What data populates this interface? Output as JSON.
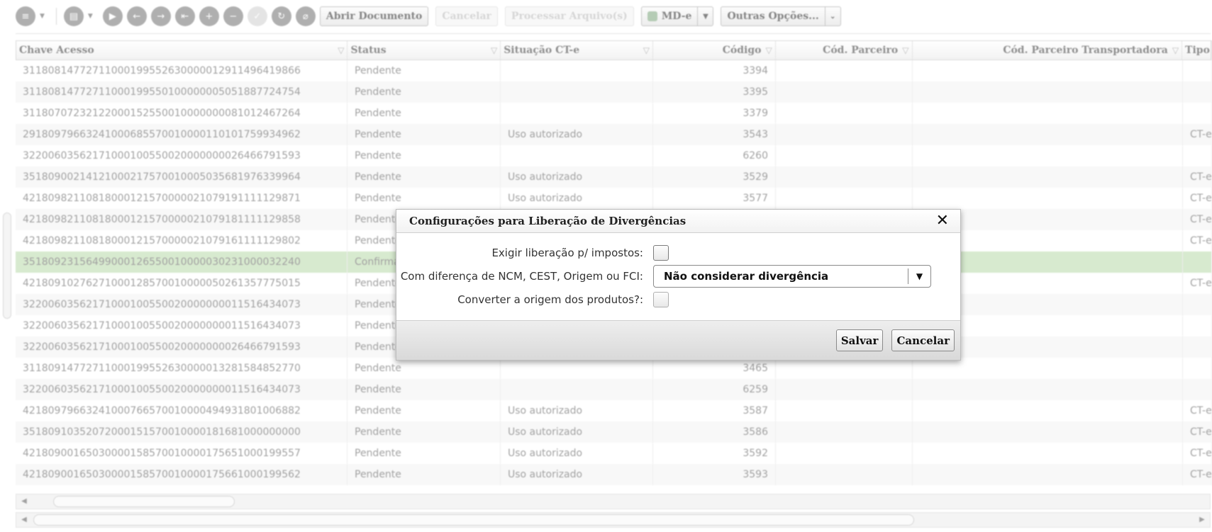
{
  "toolbar": {
    "open_document": "Abrir Documento",
    "cancel": "Cancelar",
    "process_files": "Processar Arquivo(s)",
    "mde": "MD-e",
    "other_options": "Outras Opções..."
  },
  "grid": {
    "columns": [
      "Chave Acesso",
      "Status",
      "Situação CT-e",
      "Código",
      "Cód. Parceiro",
      "Cód. Parceiro Transportadora",
      "Tipo"
    ],
    "rows": [
      {
        "chave": "31180814772711000199552630000012911496419866",
        "status": "Pendente",
        "situacao": "",
        "codigo": "3394",
        "tipo": ""
      },
      {
        "chave": "31180814772711000199550100000005051887724754",
        "status": "Pendente",
        "situacao": "",
        "codigo": "3395",
        "tipo": ""
      },
      {
        "chave": "31180707232122000152550010000000081012467264",
        "status": "Pendente",
        "situacao": "",
        "codigo": "3379",
        "tipo": ""
      },
      {
        "chave": "29180979663241000685570010000110101759934962",
        "status": "Pendente",
        "situacao": "Uso autorizado",
        "codigo": "3543",
        "tipo": "CT-e"
      },
      {
        "chave": "32200603562171000100550020000000026466791593",
        "status": "Pendente",
        "situacao": "",
        "codigo": "6260",
        "tipo": ""
      },
      {
        "chave": "35180900214121000217570010005035681976339964",
        "status": "Pendente",
        "situacao": "Uso autorizado",
        "codigo": "3529",
        "tipo": "CT-e"
      },
      {
        "chave": "42180982110818000121570000021079191111129871",
        "status": "Pendente",
        "situacao": "Uso autorizado",
        "codigo": "3577",
        "tipo": "CT-e"
      },
      {
        "chave": "42180982110818000121570000021079181111129858",
        "status": "Pendente",
        "situacao": "",
        "codigo": "",
        "tipo": "CT-e"
      },
      {
        "chave": "42180982110818000121570000021079161111129802",
        "status": "Pendente",
        "situacao": "",
        "codigo": "",
        "tipo": "CT-e"
      },
      {
        "chave": "35180923156499000126550010000030231000032240",
        "status": "Confirmado",
        "situacao": "",
        "codigo": "",
        "tipo": ""
      },
      {
        "chave": "42180910276271000128570010000050261357775015",
        "status": "Pendente",
        "situacao": "",
        "codigo": "",
        "tipo": "CT-e"
      },
      {
        "chave": "32200603562171000100550020000000011516434073",
        "status": "Pendente",
        "situacao": "",
        "codigo": "",
        "tipo": ""
      },
      {
        "chave": "32200603562171000100550020000000011516434073",
        "status": "Pendente",
        "situacao": "",
        "codigo": "",
        "tipo": ""
      },
      {
        "chave": "32200603562171000100550020000000026466791593",
        "status": "Pendente",
        "situacao": "",
        "codigo": "",
        "tipo": ""
      },
      {
        "chave": "31180914772711000199552630000013281584852770",
        "status": "Pendente",
        "situacao": "",
        "codigo": "3465",
        "tipo": ""
      },
      {
        "chave": "32200603562171000100550020000000011516434073",
        "status": "Pendente",
        "situacao": "",
        "codigo": "6259",
        "tipo": ""
      },
      {
        "chave": "42180979663241000766570010000494931801006882",
        "status": "Pendente",
        "situacao": "Uso autorizado",
        "codigo": "3587",
        "tipo": "CT-e"
      },
      {
        "chave": "35180910352072000151570010000181681000000000",
        "status": "Pendente",
        "situacao": "Uso autorizado",
        "codigo": "3586",
        "tipo": "CT-e"
      },
      {
        "chave": "42180900165030000158570010000175651000199557",
        "status": "Pendente",
        "situacao": "Uso autorizado",
        "codigo": "3592",
        "tipo": "CT-e"
      },
      {
        "chave": "42180900165030000158570010000175661000199562",
        "status": "Pendente",
        "situacao": "Uso autorizado",
        "codigo": "3593",
        "tipo": "CT-e"
      }
    ],
    "selected_row_color": "#b8d9a8"
  },
  "modal": {
    "title": "Configurações para Liberação de Divergências",
    "close_icon": "close-icon",
    "fields": {
      "require_release_label": "Exigir liberação p/ impostos:",
      "ncm_label": "Com diferença de NCM, CEST, Origem ou FCI:",
      "ncm_value": "Não considerar divergência",
      "convert_origin_label": "Converter a origem dos produtos?:"
    },
    "buttons": {
      "save": "Salvar",
      "cancel": "Cancelar"
    }
  }
}
